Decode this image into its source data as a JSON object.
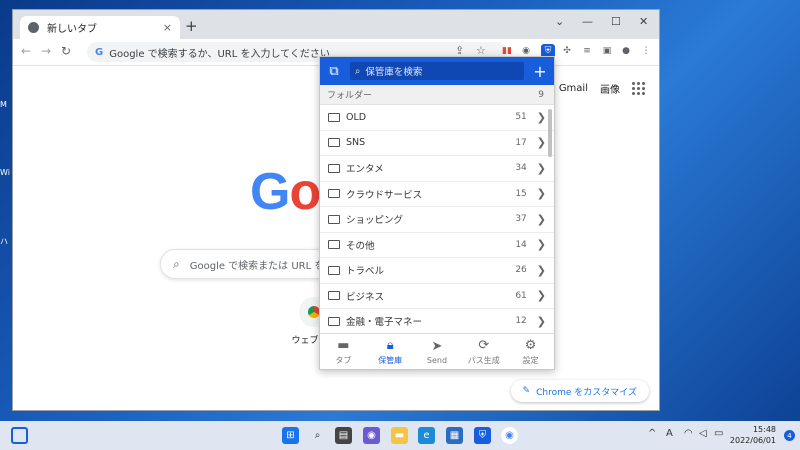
{
  "desktop": {
    "fragments": [
      "M",
      "Wi",
      "ハ"
    ]
  },
  "browser": {
    "tab_title": "新しいタブ",
    "tab_close": "×",
    "new_tab": "+",
    "window_controls": {
      "expand": "⌄",
      "minimize": "—",
      "maximize": "☐",
      "close": "✕"
    },
    "omnibox_placeholder": "Google で検索するか、URL を入力してください"
  },
  "newtab_page": {
    "links": {
      "gmail": "Gmail",
      "images": "画像"
    },
    "search_placeholder": "Google で検索または URL を",
    "shortcut_label": "ウェブスト",
    "customize_label": "Chrome をカスタマイズ"
  },
  "bitwarden": {
    "search_placeholder": "保管庫を検索",
    "folders_header": "フォルダー",
    "folders_count": "9",
    "folders": [
      {
        "name": "OLD",
        "count": "51"
      },
      {
        "name": "SNS",
        "count": "17"
      },
      {
        "name": "エンタメ",
        "count": "34"
      },
      {
        "name": "クラウドサービス",
        "count": "15"
      },
      {
        "name": "ショッピング",
        "count": "37"
      },
      {
        "name": "その他",
        "count": "14"
      },
      {
        "name": "トラベル",
        "count": "26"
      },
      {
        "name": "ビジネス",
        "count": "61"
      },
      {
        "name": "金融・電子マネー",
        "count": "12"
      }
    ],
    "nav": {
      "tab": "タブ",
      "vault": "保管庫",
      "send": "Send",
      "generator": "パス生成",
      "settings": "設定"
    }
  },
  "taskbar": {
    "tray_lang": "A",
    "time": "15:48",
    "date": "2022/06/01",
    "notifications": "4"
  },
  "colors": {
    "bitwarden_blue": "#175ddc",
    "google_blue": "#4285f4",
    "google_red": "#ea4335",
    "google_yellow": "#fbbc05"
  }
}
